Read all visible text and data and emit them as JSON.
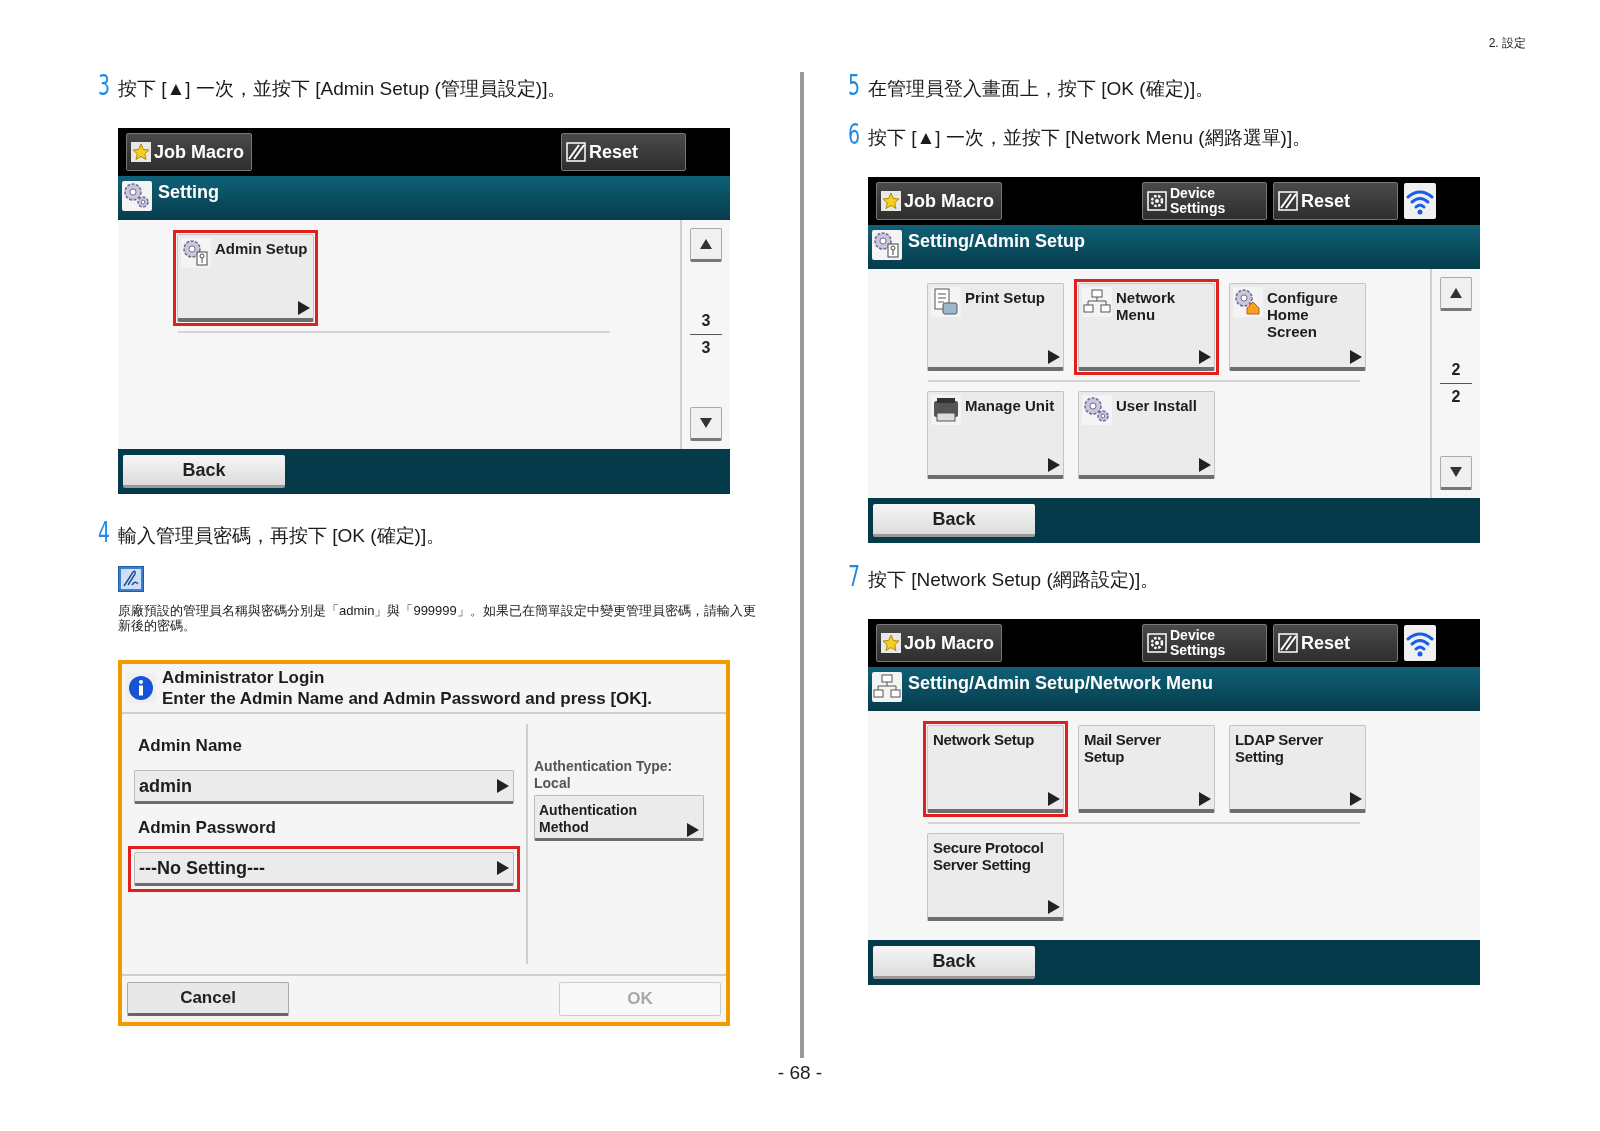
{
  "header": "2. 設定",
  "left_steps": [
    {
      "number": "3",
      "text": "按下 [▲] 一次，並按下 [Admin Setup (管理員設定)]。",
      "screen": {
        "top_buttons": [
          {
            "kind": "job_macro",
            "label": "Job Macro"
          },
          {
            "kind": "reset",
            "label": "Reset"
          }
        ],
        "title": {
          "text": "Setting",
          "kind": "gears"
        },
        "tiles": [
          {
            "label": "Admin Setup",
            "kind": "gear_key",
            "selected": true
          }
        ],
        "pager": {
          "current": "3",
          "total": "3"
        },
        "back": "Back"
      }
    },
    {
      "number": "4",
      "text": "輸入管理員密碼，再按下 [OK (確定)]。",
      "note": "原廠預設的管理員名稱與密碼分別是「admin」與「999999」。如果已在簡單設定中變更管理員密碼，請輸入更新後的密碼。",
      "dialog": {
        "title": "Administrator Login",
        "message": "Enter the Admin Name and Admin Password and press [OK].",
        "fields": [
          {
            "label": "Admin Name",
            "value": "admin",
            "selected": false
          },
          {
            "label": "Admin Password",
            "value": "---No Setting---",
            "selected": true
          }
        ],
        "auth_type_label": "Authentication Type:",
        "auth_type_value": "Local",
        "auth_button": "Authentication Method",
        "buttons": [
          {
            "label": "Cancel",
            "disabled": false
          },
          {
            "label": "OK",
            "disabled": true
          }
        ]
      }
    }
  ],
  "right_steps": [
    {
      "number": "5",
      "text": "在管理員登入畫面上，按下 [OK (確定)]。"
    },
    {
      "number": "6",
      "text": "按下 [▲] 一次，並按下 [Network Menu (網路選單)]。",
      "screen": {
        "top_buttons": [
          {
            "kind": "job_macro",
            "label": "Job Macro"
          },
          {
            "kind": "device_settings",
            "label": "Device Settings"
          },
          {
            "kind": "reset",
            "label": "Reset"
          },
          {
            "kind": "wifi"
          }
        ],
        "title": {
          "text": "Setting/Admin Setup",
          "kind": "gear_key"
        },
        "tiles": [
          {
            "label": "Print Setup",
            "kind": "document",
            "selected": false
          },
          {
            "label": "Network Menu",
            "kind": "network",
            "selected": true
          },
          {
            "label": "Configure Home Screen",
            "kind": "gear_home",
            "selected": false
          },
          {
            "label": "Manage Unit",
            "kind": "printer",
            "selected": false
          },
          {
            "label": "User Install",
            "kind": "gears",
            "selected": false
          }
        ],
        "pager": {
          "current": "2",
          "total": "2"
        },
        "back": "Back"
      }
    },
    {
      "number": "7",
      "text": "按下 [Network Setup (網路設定)]。",
      "screen": {
        "top_buttons": [
          {
            "kind": "job_macro",
            "label": "Job Macro"
          },
          {
            "kind": "device_settings",
            "label": "Device Settings"
          },
          {
            "kind": "reset",
            "label": "Reset"
          },
          {
            "kind": "wifi"
          }
        ],
        "title": {
          "text": "Setting/Admin Setup/Network Menu",
          "kind": "network"
        },
        "tiles": [
          {
            "label": "Network Setup",
            "kind": "none",
            "selected": true
          },
          {
            "label": "Mail Server Setup",
            "kind": "none",
            "selected": false
          },
          {
            "label": "LDAP Server Setting",
            "kind": "none",
            "selected": false
          },
          {
            "label": "Secure Protocol Server Setting",
            "kind": "none",
            "selected": false
          }
        ],
        "back": "Back"
      }
    }
  ],
  "page_number": "- 68 -"
}
